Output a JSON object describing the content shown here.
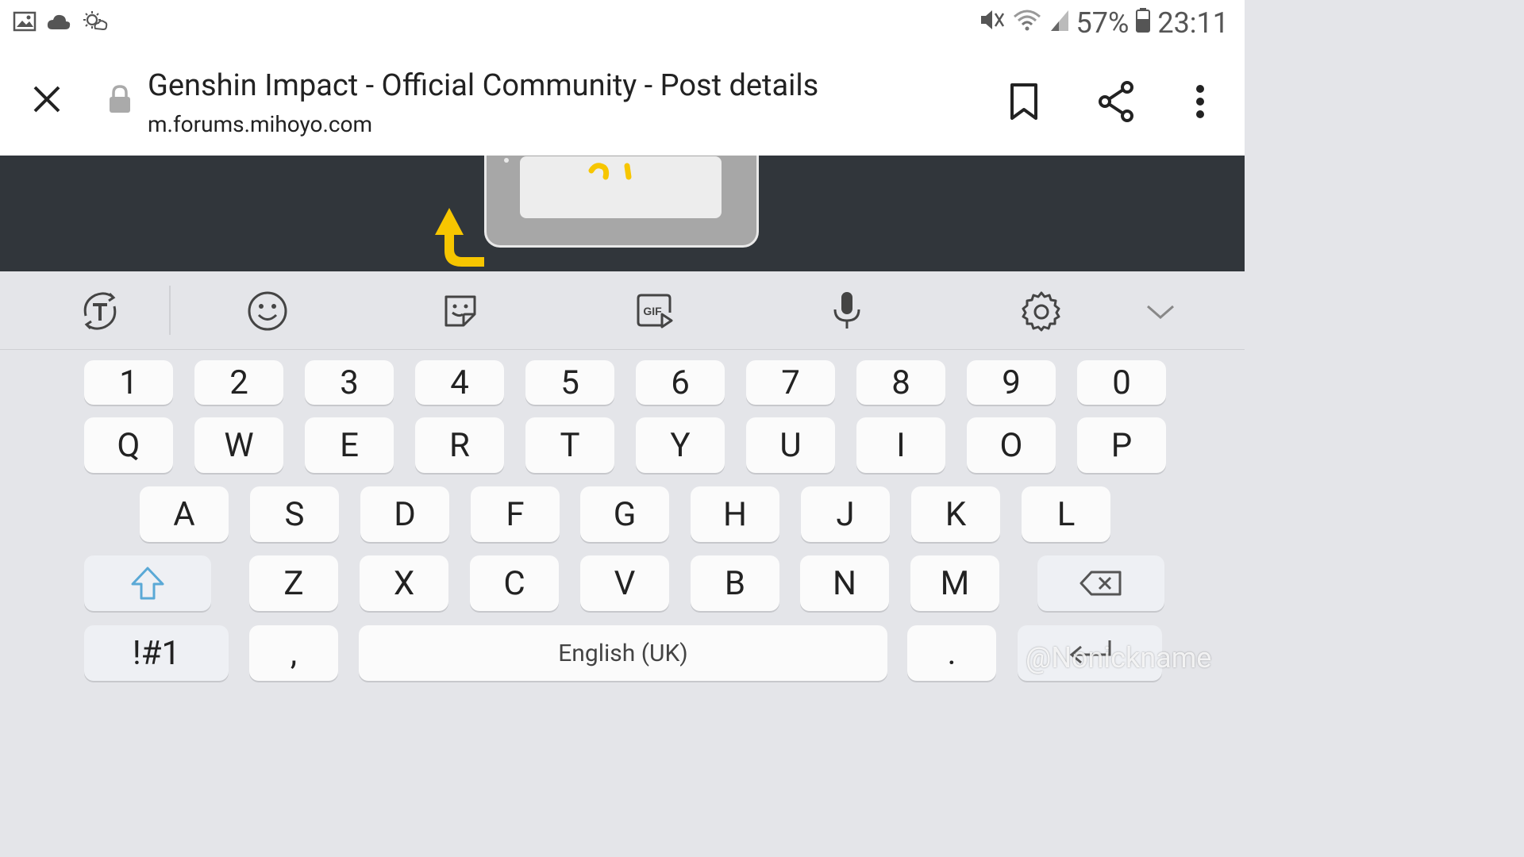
{
  "status_bar": {
    "battery": "57%",
    "time": "23:11",
    "icons_left": [
      "image-icon",
      "cloud-icon",
      "weather-icon"
    ],
    "icons_right": [
      "mute-icon",
      "wifi-icon",
      "signal-icon",
      "battery-icon"
    ]
  },
  "browser": {
    "title": "Genshin Impact - Official Community - Post details",
    "url": "m.forums.mihoyo.com"
  },
  "keyboard": {
    "toolbar": [
      "translate-icon",
      "emoji-icon",
      "sticker-icon",
      "gif-icon",
      "microphone-icon",
      "settings-icon",
      "collapse-chevron-icon"
    ],
    "gif_label": "GIF",
    "number_row": [
      "1",
      "2",
      "3",
      "4",
      "5",
      "6",
      "7",
      "8",
      "9",
      "0"
    ],
    "row1": [
      "Q",
      "W",
      "E",
      "R",
      "T",
      "Y",
      "U",
      "I",
      "O",
      "P"
    ],
    "row2": [
      "A",
      "S",
      "D",
      "F",
      "G",
      "H",
      "J",
      "K",
      "L"
    ],
    "row3": [
      "Z",
      "X",
      "C",
      "V",
      "B",
      "N",
      "M"
    ],
    "symbols_label": "!#1",
    "comma_label": ",",
    "space_label": "English (UK)",
    "period_label": "."
  },
  "watermark": "@Nonickname",
  "colors": {
    "content_bg": "#31363b",
    "keyboard_bg": "#e4e5e9",
    "shift_accent": "#5aa9d6",
    "arrow_yellow": "#f7c600"
  }
}
